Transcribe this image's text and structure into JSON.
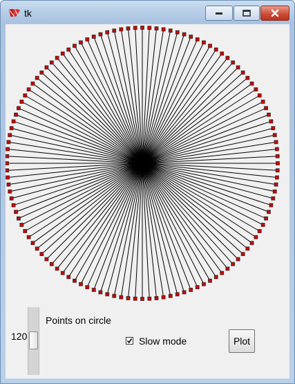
{
  "window": {
    "title": "tk",
    "icon": "tk-feather-icon",
    "buttons": [
      "minimize-icon",
      "maximize-icon",
      "close-icon"
    ]
  },
  "canvas": {
    "points_on_circle": 120,
    "line_color": "#000000",
    "marker_color": "#cc0000",
    "marker_outline": "#333333"
  },
  "controls": {
    "scale_value": "120",
    "scale_label": "Points on circle",
    "slow_mode_label": "Slow mode",
    "slow_mode_checked": true,
    "plot_label": "Plot"
  }
}
